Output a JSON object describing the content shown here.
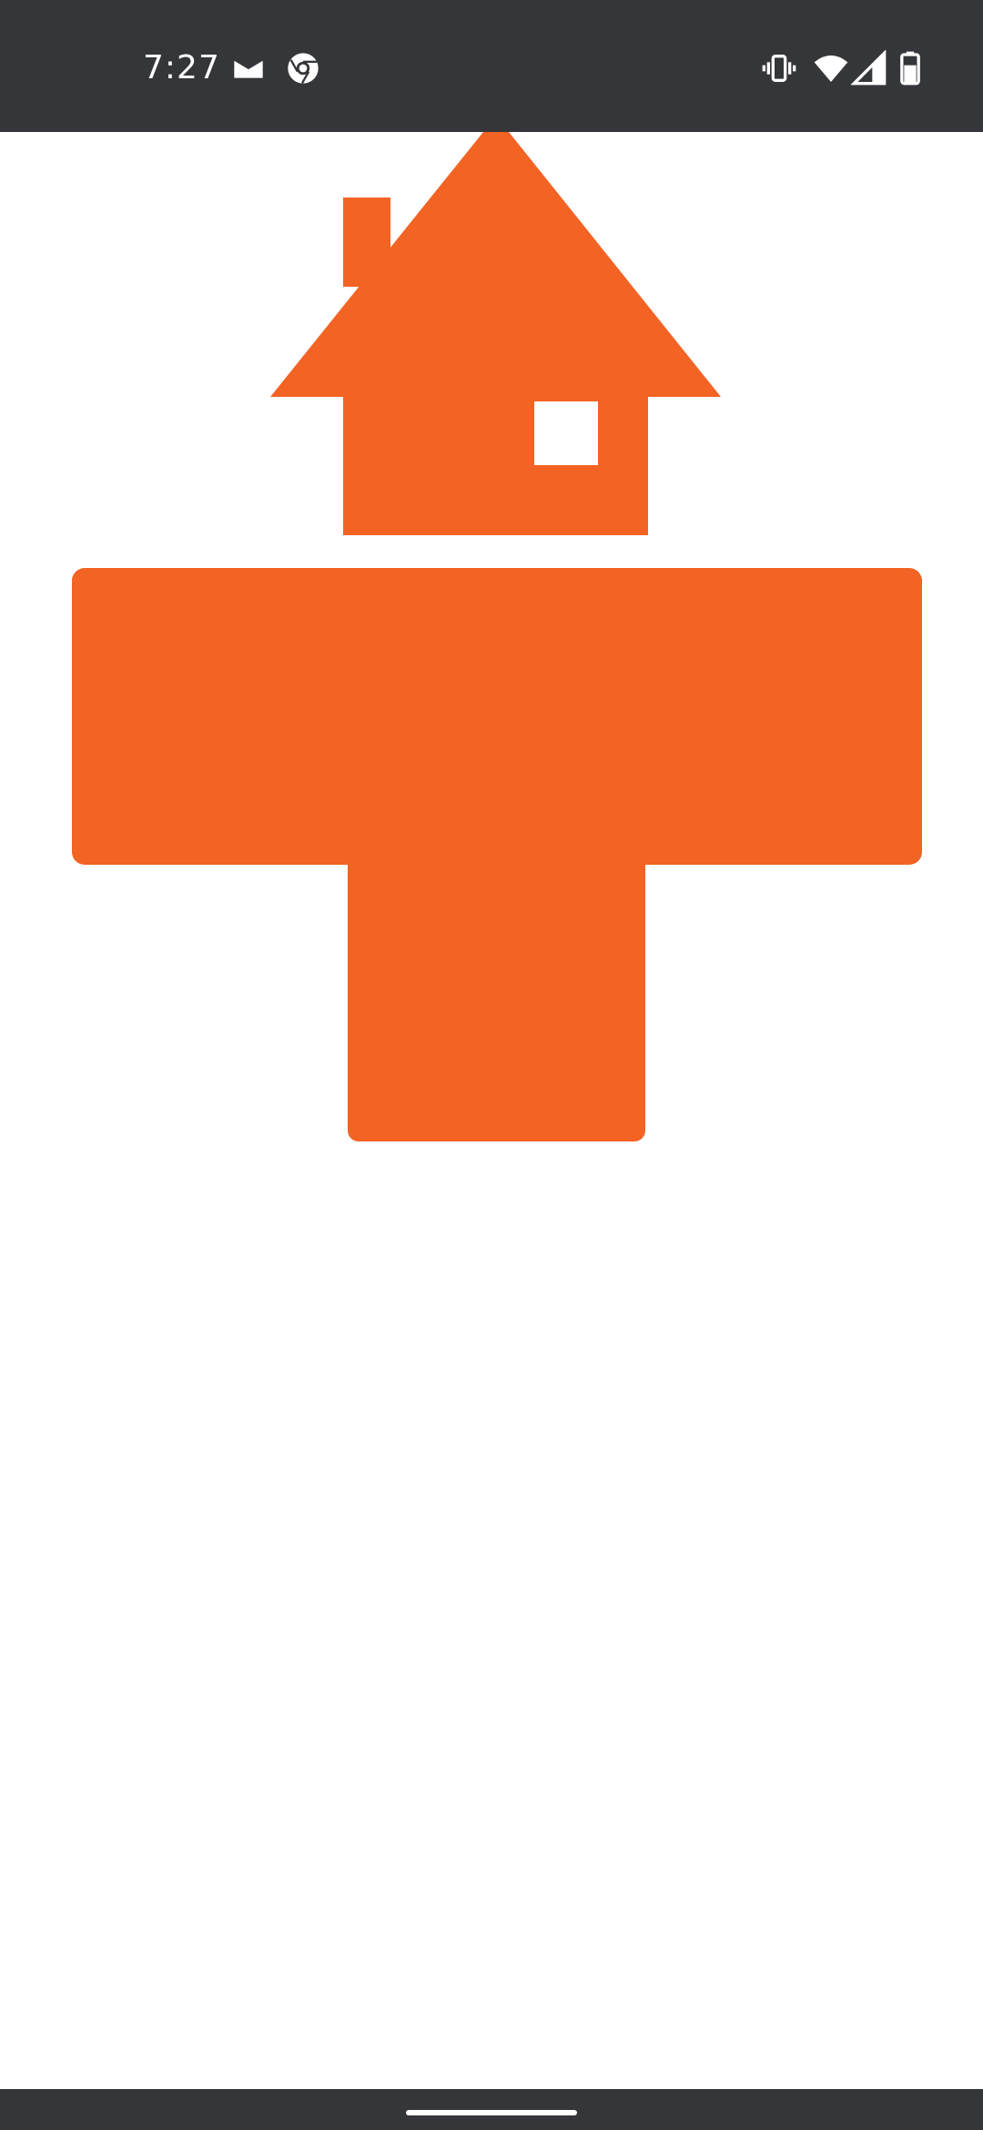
{
  "status_bar": {
    "time": "7:27",
    "icons": [
      "email-icon",
      "chrome-icon",
      "vibrate-icon",
      "wifi-icon",
      "signal-icon",
      "battery-icon"
    ],
    "background": "#35363a",
    "foreground": "#ffffff"
  },
  "content": {
    "graphic_icons": [
      "house-icon",
      "t-shape-icon"
    ],
    "accent_color": "#f26324",
    "background": "#ffffff"
  },
  "nav_bar": {
    "background": "#35363a",
    "indicator_color": "#ffffff"
  }
}
